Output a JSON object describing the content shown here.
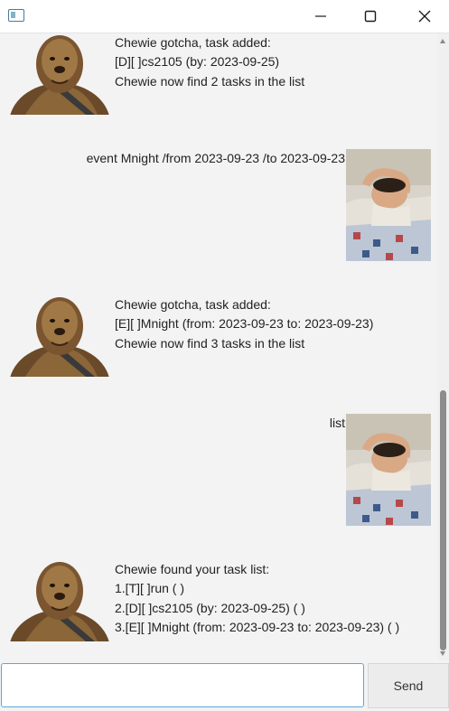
{
  "window": {
    "icon": "app-window-icon",
    "controls": [
      "minimize-icon",
      "maximize-icon",
      "close-icon"
    ]
  },
  "messages": [
    {
      "sender": "bot",
      "avatar": "chewbacca-avatar",
      "text": "Chewie gotcha, task added:\n[D][ ]cs2105 (by: 2023-09-25)\nChewie now find 2 tasks in the list"
    },
    {
      "sender": "user",
      "avatar": "user-avatar",
      "text": "event Mnight /from 2023-09-23 /to 2023-09-23"
    },
    {
      "sender": "bot",
      "avatar": "chewbacca-avatar",
      "text": "Chewie gotcha, task added:\n[E][ ]Mnight (from: 2023-09-23 to: 2023-09-23)\nChewie now find 3 tasks in the list"
    },
    {
      "sender": "user",
      "avatar": "user-avatar",
      "text": "list"
    },
    {
      "sender": "bot",
      "avatar": "chewbacca-avatar",
      "text": "Chewie found your task list:\n1.[T][ ]run ( )\n2.[D][ ]cs2105 (by: 2023-09-25) ( )\n3.[E][ ]Mnight (from: 2023-09-23 to: 2023-09-23) ( )"
    }
  ],
  "input": {
    "value": "",
    "placeholder": ""
  },
  "send_label": "Send"
}
